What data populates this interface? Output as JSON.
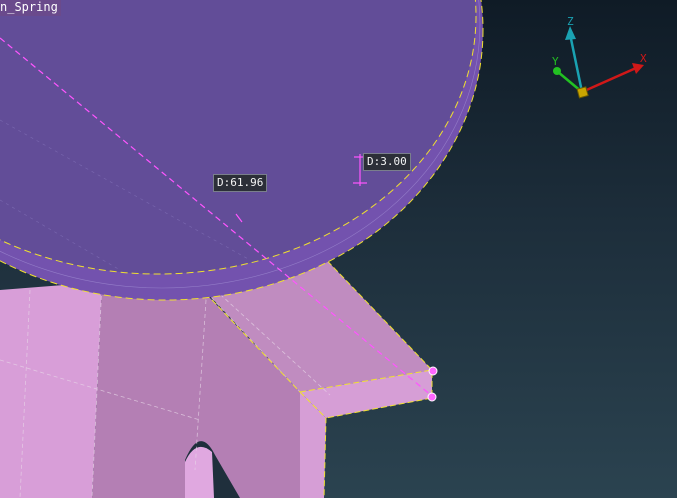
{
  "viewport": {
    "model_name": "n_Spring"
  },
  "dimensions": [
    {
      "id": "diameter",
      "label": "D:61.96"
    },
    {
      "id": "depth",
      "label": "D:3.00"
    }
  ],
  "triad": {
    "x_label": "X",
    "y_label": "Y",
    "z_label": "Z",
    "colors": {
      "x": "#d01818",
      "y": "#22c122",
      "z": "#1aa2b2",
      "origin": "#c9a400"
    }
  },
  "colors": {
    "background_top": "#0f1b26",
    "background_bottom": "#2b4350",
    "disc_face": "#644e9a",
    "disc_rim": "#7655b0",
    "bracket_light": "#d69ed6",
    "bracket_mid": "#b583b5",
    "edge_highlight": "#f0e030",
    "dimension_line": "#ff55ff"
  }
}
